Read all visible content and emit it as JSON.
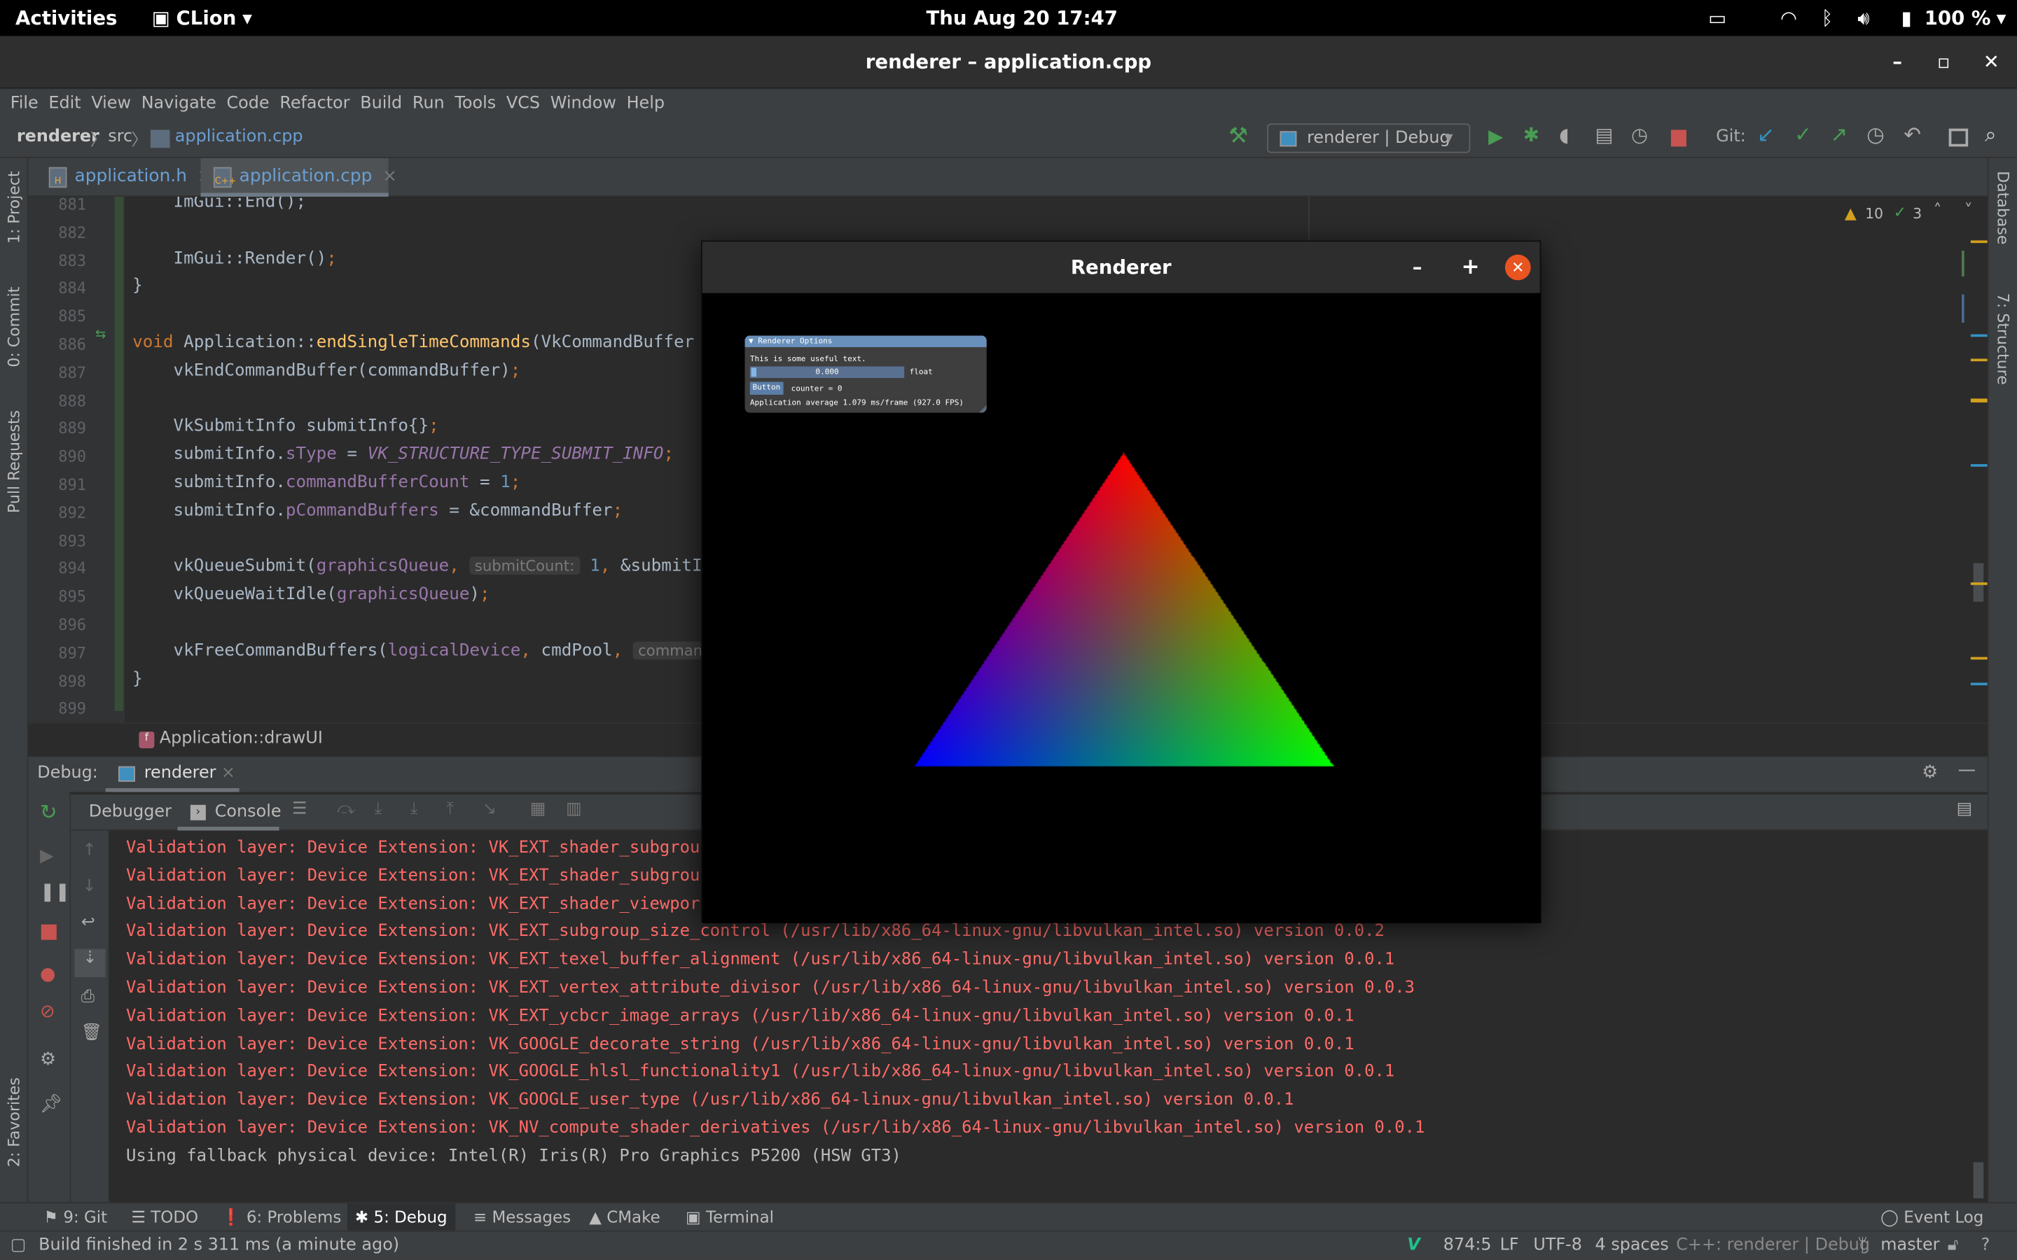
{
  "system_bar": {
    "activities": "Activities",
    "app": "CLion",
    "clock": "Thu Aug 20  17:47",
    "battery": "100 %"
  },
  "window": {
    "title": "renderer – application.cpp"
  },
  "menu": [
    "File",
    "Edit",
    "View",
    "Navigate",
    "Code",
    "Refactor",
    "Build",
    "Run",
    "Tools",
    "VCS",
    "Window",
    "Help"
  ],
  "nav": {
    "breadcrumb": [
      "renderer",
      "src",
      "application.cpp"
    ],
    "run_config": "renderer | Debug",
    "git_label": "Git:"
  },
  "left_stripe": [
    "1: Project",
    "0: Commit",
    "Pull Requests",
    "2: Favorites"
  ],
  "right_stripe": [
    "Database",
    "7: Structure"
  ],
  "editor_tabs": [
    {
      "label": "application.h",
      "active": false
    },
    {
      "label": "application.cpp",
      "active": true
    }
  ],
  "inspections": {
    "warnings": "10",
    "weak_warnings": "3"
  },
  "code": {
    "line_numbers": [
      "881",
      "882",
      "883",
      "884",
      "885",
      "886",
      "887",
      "888",
      "889",
      "890",
      "891",
      "892",
      "893",
      "894",
      "895",
      "896",
      "897",
      "898",
      "899"
    ],
    "lines": [
      [
        [
          "    ImGui::End",
          "t"
        ],
        [
          "();",
          "p"
        ]
      ],
      [],
      [
        [
          "    ImGui::Render()",
          "t"
        ],
        [
          ";",
          "punc"
        ]
      ],
      [
        [
          "}",
          "t"
        ]
      ],
      [],
      [
        [
          "void",
          "kw"
        ],
        [
          " Application::",
          "t"
        ],
        [
          "endSingleTimeCommands",
          "fn"
        ],
        [
          "(VkCommandBuffer co",
          "t"
        ]
      ],
      [
        [
          "    vkEndCommandBuffer(commandBuffer)",
          "t"
        ],
        [
          ";",
          "punc"
        ]
      ],
      [],
      [
        [
          "    VkSubmitInfo submitInfo{}",
          "t"
        ],
        [
          ";",
          "punc"
        ]
      ],
      [
        [
          "    submitInfo.",
          "t"
        ],
        [
          "sType",
          "fld"
        ],
        [
          " = ",
          "t"
        ],
        [
          "VK_STRUCTURE_TYPE_SUBMIT_INFO",
          "const"
        ],
        [
          ";",
          "punc"
        ]
      ],
      [
        [
          "    submitInfo.",
          "t"
        ],
        [
          "commandBufferCount",
          "fld"
        ],
        [
          " = ",
          "t"
        ],
        [
          "1",
          "num"
        ],
        [
          ";",
          "punc"
        ]
      ],
      [
        [
          "    submitInfo.",
          "t"
        ],
        [
          "pCommandBuffers",
          "fld"
        ],
        [
          " = &commandBuffer",
          "t"
        ],
        [
          ";",
          "punc"
        ]
      ],
      [],
      [
        [
          "    vkQueueSubmit(",
          "t"
        ],
        [
          "graphicsQueue",
          "fld"
        ],
        [
          ", ",
          "punc"
        ],
        [
          "submitCount:",
          "hint"
        ],
        [
          " 1",
          "num"
        ],
        [
          ", ",
          "punc"
        ],
        [
          "&submitInfo",
          "t"
        ]
      ],
      [
        [
          "    vkQueueWaitIdle(",
          "t"
        ],
        [
          "graphicsQueue",
          "fld"
        ],
        [
          ")",
          "t"
        ],
        [
          ";",
          "punc"
        ]
      ],
      [],
      [
        [
          "    vkFreeCommandBuffers(",
          "t"
        ],
        [
          "logicalDevice",
          "fld"
        ],
        [
          ", ",
          "punc"
        ],
        [
          "cmdPool",
          "t"
        ],
        [
          ", ",
          "punc"
        ],
        [
          "commandB",
          "hint"
        ]
      ],
      [
        [
          "}",
          "t"
        ]
      ],
      []
    ]
  },
  "structure_crumb": "Application::drawUI",
  "debug": {
    "label": "Debug:",
    "session": "renderer",
    "tabs": [
      "Debugger",
      "Console"
    ],
    "console": [
      {
        "text": "Validation layer: Device Extension: VK_EXT_shader_subgroup_",
        "kind": "error"
      },
      {
        "text": "Validation layer: Device Extension: VK_EXT_shader_subgroup_",
        "kind": "error"
      },
      {
        "text": "Validation layer: Device Extension: VK_EXT_shader_viewport_",
        "kind": "error"
      },
      {
        "text": "Validation layer: Device Extension: VK_EXT_subgroup_size_control (/usr/lib/x86_64-linux-gnu/libvulkan_intel.so) version 0.0.2",
        "kind": "error"
      },
      {
        "text": "Validation layer: Device Extension: VK_EXT_texel_buffer_alignment (/usr/lib/x86_64-linux-gnu/libvulkan_intel.so) version 0.0.1",
        "kind": "error"
      },
      {
        "text": "Validation layer: Device Extension: VK_EXT_vertex_attribute_divisor (/usr/lib/x86_64-linux-gnu/libvulkan_intel.so) version 0.0.3",
        "kind": "error"
      },
      {
        "text": "Validation layer: Device Extension: VK_EXT_ycbcr_image_arrays (/usr/lib/x86_64-linux-gnu/libvulkan_intel.so) version 0.0.1",
        "kind": "error"
      },
      {
        "text": "Validation layer: Device Extension: VK_GOOGLE_decorate_string (/usr/lib/x86_64-linux-gnu/libvulkan_intel.so) version 0.0.1",
        "kind": "error"
      },
      {
        "text": "Validation layer: Device Extension: VK_GOOGLE_hlsl_functionality1 (/usr/lib/x86_64-linux-gnu/libvulkan_intel.so) version 0.0.1",
        "kind": "error"
      },
      {
        "text": "Validation layer: Device Extension: VK_GOOGLE_user_type (/usr/lib/x86_64-linux-gnu/libvulkan_intel.so) version 0.0.1",
        "kind": "error"
      },
      {
        "text": "Validation layer: Device Extension: VK_NV_compute_shader_derivatives (/usr/lib/x86_64-linux-gnu/libvulkan_intel.so) version 0.0.1",
        "kind": "error"
      },
      {
        "text": "Using fallback physical device: Intel(R) Iris(R) Pro Graphics P5200 (HSW GT3)",
        "kind": "info"
      }
    ]
  },
  "tool_tabs": [
    {
      "label": "9: Git"
    },
    {
      "label": "TODO"
    },
    {
      "label": "6: Problems"
    },
    {
      "label": "5: Debug",
      "active": true
    },
    {
      "label": "Messages"
    },
    {
      "label": "CMake"
    },
    {
      "label": "Terminal"
    }
  ],
  "event_log": "Event Log",
  "status": {
    "message": "Build finished in 2 s 311 ms (a minute ago)",
    "position": "874:5",
    "line_sep": "LF",
    "encoding": "UTF-8",
    "indent": "4 spaces",
    "context": "C++: renderer | Debug",
    "branch": "master"
  },
  "renderer_window": {
    "title": "Renderer",
    "imgui": {
      "title": "Renderer Options",
      "text": "This is some useful text.",
      "slider_value": "0.000",
      "slider_fraction": 0.0,
      "slider_label": "float",
      "button": "Button",
      "counter": "counter = 0",
      "fps": "Application average 1.079 ms/frame (927.0 FPS)"
    },
    "triangle_colors": {
      "top": "#ff0000",
      "bottom_left": "#0000ff",
      "bottom_right": "#00ff00"
    }
  },
  "colors": {
    "accent_blue": "#6a9fd4",
    "error_text": "#ff6b68",
    "run_green": "#499c54",
    "stop_red": "#c75450",
    "close_orange": "#e95420"
  }
}
